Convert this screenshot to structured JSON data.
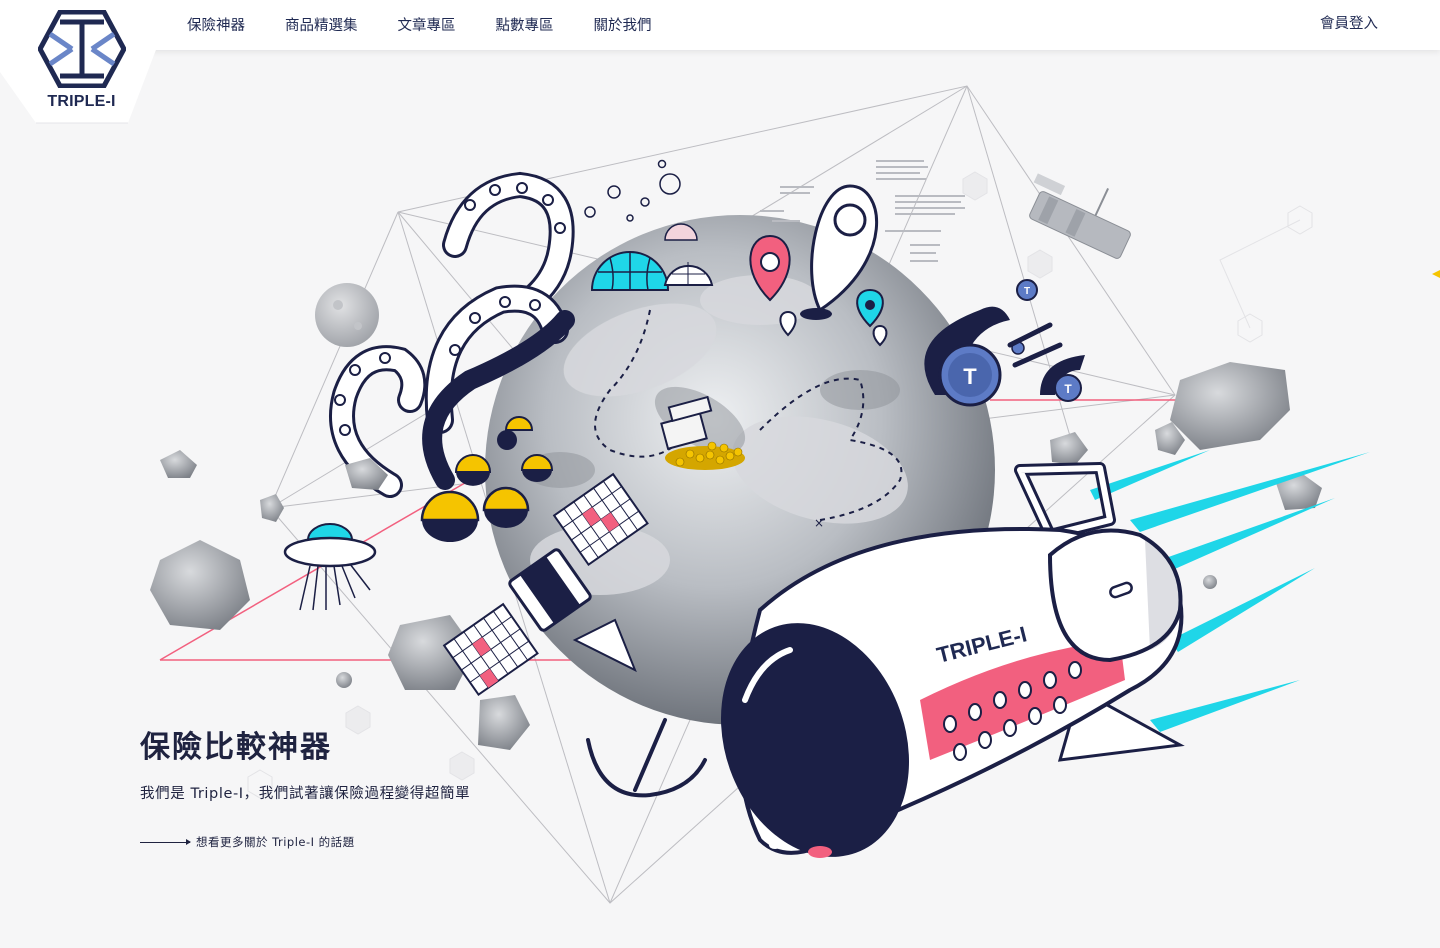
{
  "brand": {
    "name": "TRIPLE-I",
    "color": "#1f2952",
    "accent_blue": "#6a86c8"
  },
  "nav": {
    "items": [
      {
        "label": "保險神器"
      },
      {
        "label": "商品精選集"
      },
      {
        "label": "文章專區"
      },
      {
        "label": "點數專區"
      },
      {
        "label": "關於我們"
      }
    ],
    "login_label": "會員登入"
  },
  "hero": {
    "title": "保險比較神器",
    "subtitle": "我們是 Triple-I，我們試著讓保險過程變得超簡單",
    "link_label": "想看更多關於 Triple-I 的話題"
  },
  "illustration": {
    "rocket_label": "TRIPLE-I",
    "coin_letter": "T",
    "colors": {
      "pink": "#f2607f",
      "cyan": "#1fd6e8",
      "navy": "#1b1f45",
      "gold": "#f5c400"
    }
  }
}
